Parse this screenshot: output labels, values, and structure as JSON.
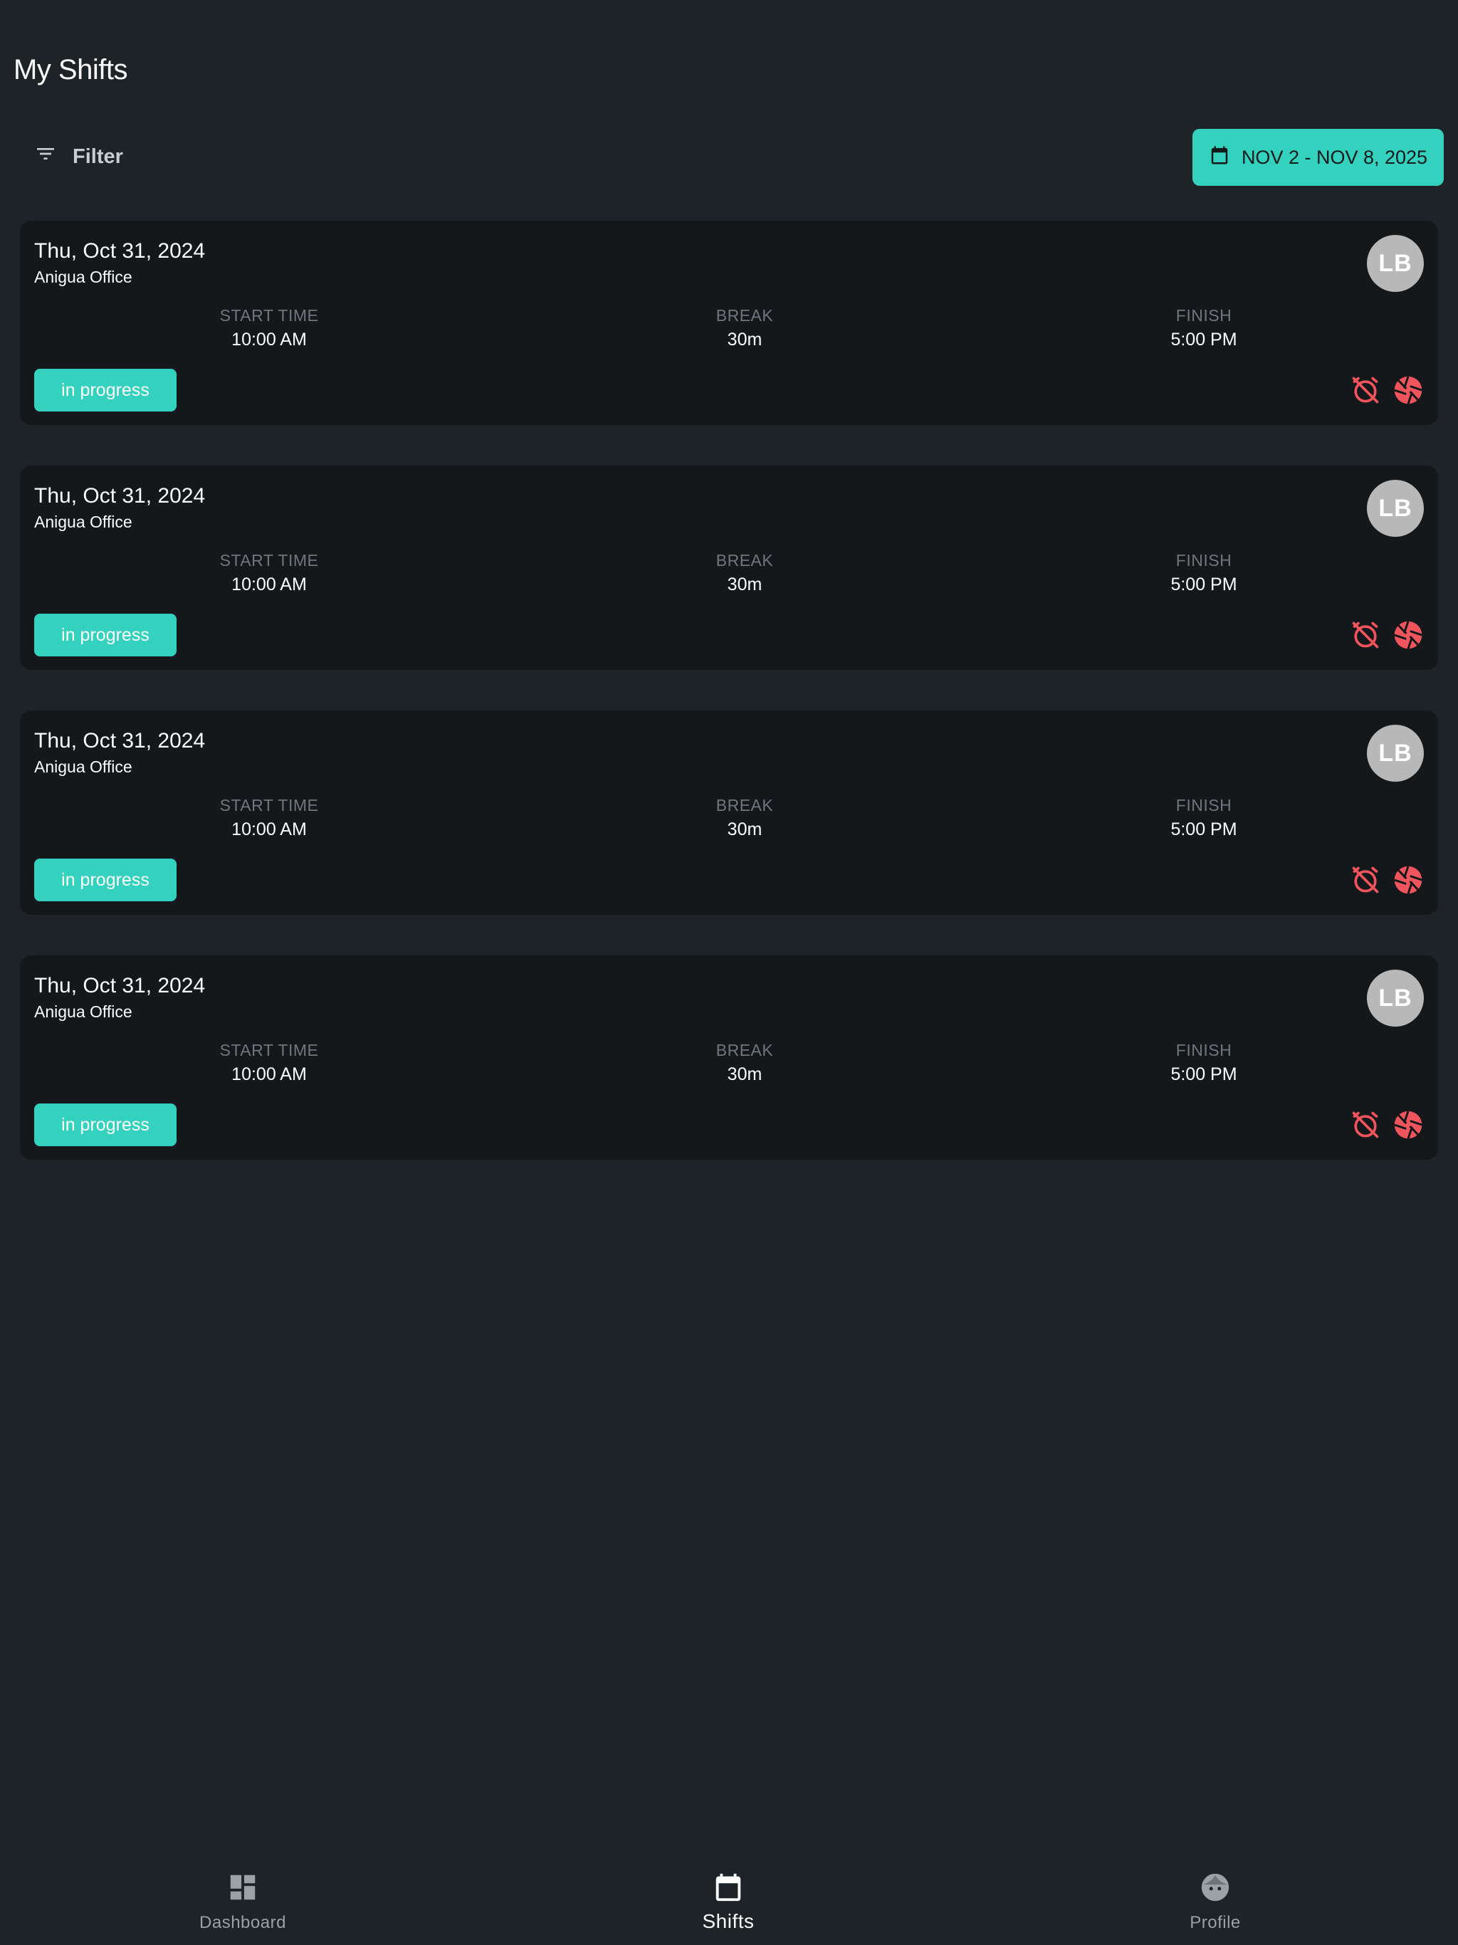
{
  "header": {
    "title": "My Shifts"
  },
  "toolbar": {
    "filter_label": "Filter",
    "date_range": "NOV 2 - NOV 8, 2025"
  },
  "shifts": [
    {
      "date": "Thu, Oct 31, 2024",
      "location": "Anigua Office",
      "initials": "LB",
      "start_label": "START TIME",
      "start": "10:00 AM",
      "break_label": "BREAK",
      "break": "30m",
      "finish_label": "FINISH",
      "finish": "5:00 PM",
      "status": "in progress"
    },
    {
      "date": "Thu, Oct 31, 2024",
      "location": "Anigua Office",
      "initials": "LB",
      "start_label": "START TIME",
      "start": "10:00 AM",
      "break_label": "BREAK",
      "break": "30m",
      "finish_label": "FINISH",
      "finish": "5:00 PM",
      "status": "in progress"
    },
    {
      "date": "Thu, Oct 31, 2024",
      "location": "Anigua Office",
      "initials": "LB",
      "start_label": "START TIME",
      "start": "10:00 AM",
      "break_label": "BREAK",
      "break": "30m",
      "finish_label": "FINISH",
      "finish": "5:00 PM",
      "status": "in progress"
    },
    {
      "date": "Thu, Oct 31, 2024",
      "location": "Anigua Office",
      "initials": "LB",
      "start_label": "START TIME",
      "start": "10:00 AM",
      "break_label": "BREAK",
      "break": "30m",
      "finish_label": "FINISH",
      "finish": "5:00 PM",
      "status": "in progress"
    }
  ],
  "nav": {
    "dashboard": "Dashboard",
    "shifts": "Shifts",
    "profile": "Profile"
  },
  "icons": {
    "filter": "filter-icon",
    "calendar": "calendar-icon",
    "alarm_off": "alarm-off-icon",
    "shutter": "camera-shutter-icon",
    "dashboard": "dashboard-icon",
    "profile": "face-icon"
  },
  "colors": {
    "background": "#1d2327",
    "card": "#15181b",
    "accent": "#34d1be",
    "alert": "#f0545c",
    "avatar": "#b8b8b8"
  }
}
